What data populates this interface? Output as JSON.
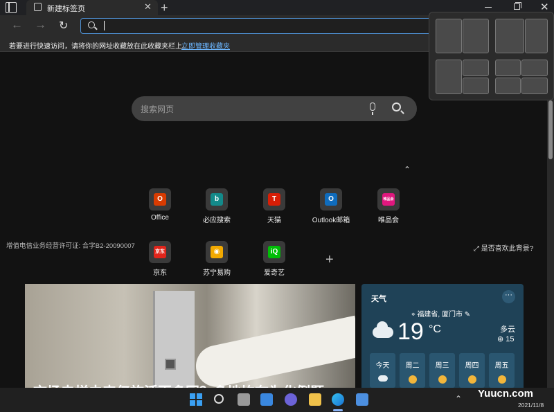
{
  "titlebar": {
    "tab_title": "新建标签页",
    "tab_close": "✕",
    "new_tab": "+",
    "close": "✕"
  },
  "toolbar": {
    "back": "←",
    "forward": "→",
    "refresh": "↻"
  },
  "favorites_bar": {
    "text": "若要进行快速访问，请将你的网址收藏放在此收藏夹栏上。",
    "link": "立即管理收藏夹"
  },
  "search": {
    "placeholder": "搜索网页"
  },
  "collapse": "⌃",
  "quick_links": [
    {
      "label": "Office",
      "glyph": "O",
      "color": "#d83b01"
    },
    {
      "label": "必应搜索",
      "glyph": "b",
      "color": "#138a8a"
    },
    {
      "label": "天猫",
      "glyph": "T",
      "color": "#d81e06"
    },
    {
      "label": "Outlook邮箱",
      "glyph": "O",
      "color": "#0f6cbd"
    },
    {
      "label": "唯品会",
      "glyph": "唯品会",
      "color": "#e0177e"
    },
    {
      "label": "京东",
      "glyph": "京东",
      "color": "#e1251b"
    },
    {
      "label": "苏宁易购",
      "glyph": "◉",
      "color": "#f2a900"
    },
    {
      "label": "爱奇艺",
      "glyph": "iQ",
      "color": "#00be06"
    }
  ],
  "add_tile": "+",
  "license": "增值电信业务经营许可证: 合字B2-20090007",
  "background_prompt": "⤢  是否喜欢此背景?",
  "hero": {
    "headline": "市场电梯未来亿施活更多同？多地均在为化例题"
  },
  "weather": {
    "title": "天气",
    "more": "···",
    "location": "⌖ 福建省, 厦门市 ✎",
    "temperature": "19",
    "unit": "°C",
    "condition": "多云",
    "aqi": "⊛ 15",
    "days": [
      {
        "label": "今天",
        "icon": "cloudy"
      },
      {
        "label": "周二",
        "icon": "sun"
      },
      {
        "label": "周三",
        "icon": "sun"
      },
      {
        "label": "周四",
        "icon": "sun"
      },
      {
        "label": "周五",
        "icon": "sun"
      }
    ]
  },
  "taskbar": {
    "tray_chevron": "⌃",
    "watermark": "Yuucn.com",
    "date": "2021/11/8"
  }
}
